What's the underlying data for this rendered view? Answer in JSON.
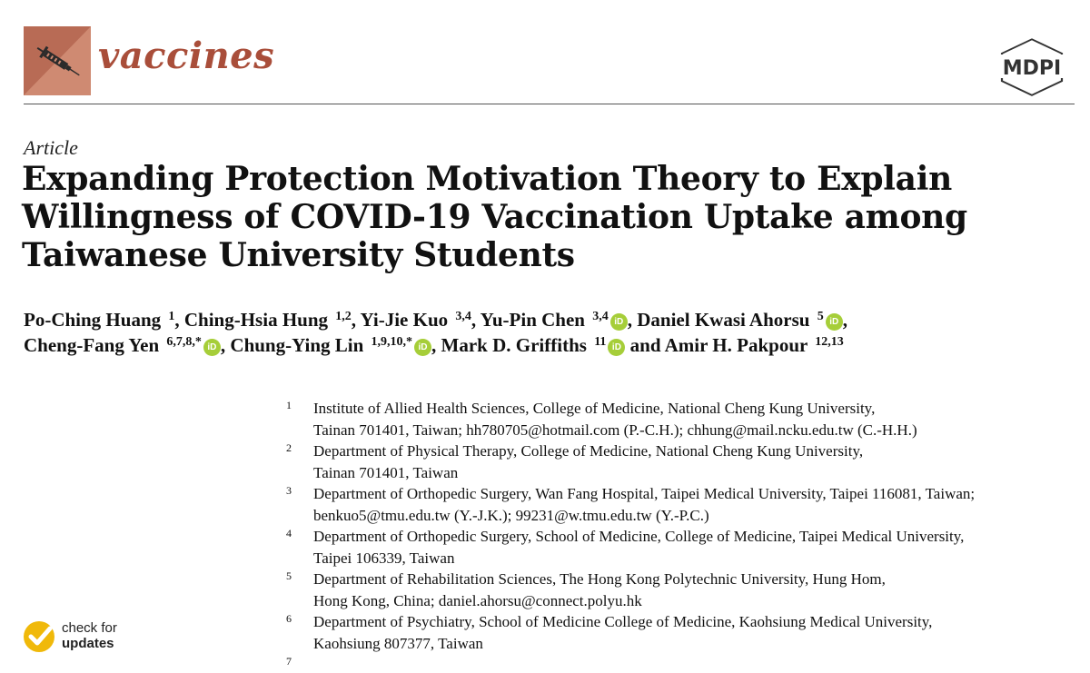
{
  "journal": {
    "name": "vaccines",
    "publisher": "MDPI"
  },
  "article_type": "Article",
  "title": "Expanding Protection Motivation Theory to Explain Willingness of COVID-19 Vaccination Uptake among Taiwanese University Students",
  "authors": [
    {
      "name": "Po-Ching Huang",
      "sup": "1",
      "orcid": false,
      "sep": ","
    },
    {
      "name": "Ching-Hsia Hung",
      "sup": "1,2",
      "orcid": false,
      "sep": ","
    },
    {
      "name": "Yi-Jie Kuo",
      "sup": "3,4",
      "orcid": false,
      "sep": ","
    },
    {
      "name": "Yu-Pin Chen",
      "sup": "3,4",
      "orcid": true,
      "sep": ","
    },
    {
      "name": "Daniel Kwasi Ahorsu",
      "sup": "5",
      "orcid": true,
      "sep": ","
    },
    {
      "name": "Cheng-Fang Yen",
      "sup": "6,7,8,*",
      "orcid": true,
      "sep": ","
    },
    {
      "name": "Chung-Ying Lin",
      "sup": "1,9,10,*",
      "orcid": true,
      "sep": ","
    },
    {
      "name": "Mark D. Griffiths",
      "sup": "11",
      "orcid": true,
      "sep": " and"
    },
    {
      "name": "Amir H. Pakpour",
      "sup": "12,13",
      "orcid": false,
      "sep": ""
    }
  ],
  "orcid_label": "iD",
  "affiliations": [
    {
      "num": "1",
      "lines": [
        "Institute of Allied Health Sciences, College of Medicine, National Cheng Kung University,",
        "Tainan 701401, Taiwan; hh780705@hotmail.com (P.-C.H.); chhung@mail.ncku.edu.tw (C.-H.H.)"
      ]
    },
    {
      "num": "2",
      "lines": [
        "Department of Physical Therapy, College of Medicine, National Cheng Kung University,",
        "Tainan 701401, Taiwan"
      ]
    },
    {
      "num": "3",
      "lines": [
        "Department of Orthopedic Surgery, Wan Fang Hospital, Taipei Medical University, Taipei 116081, Taiwan;",
        "benkuo5@tmu.edu.tw (Y.-J.K.); 99231@w.tmu.edu.tw (Y.-P.C.)"
      ]
    },
    {
      "num": "4",
      "lines": [
        "Department of Orthopedic Surgery, School of Medicine, College of Medicine, Taipei Medical University,",
        "Taipei 106339, Taiwan"
      ]
    },
    {
      "num": "5",
      "lines": [
        "Department of Rehabilitation Sciences, The Hong Kong Polytechnic University, Hung Hom,",
        "Hong Kong, China; daniel.ahorsu@connect.polyu.hk"
      ]
    },
    {
      "num": "6",
      "lines": [
        "Department of Psychiatry, School of Medicine College of Medicine, Kaohsiung Medical University,",
        "Kaohsiung 807377, Taiwan"
      ]
    },
    {
      "num": "7",
      "lines": [
        ""
      ]
    }
  ],
  "check_updates": {
    "line1": "check for",
    "line2": "updates"
  },
  "colors": {
    "journal_brand": "#a94e3a",
    "logo_bg": "#b86b55",
    "orcid_green": "#a6ce39",
    "check_yellow": "#f0b90a"
  }
}
